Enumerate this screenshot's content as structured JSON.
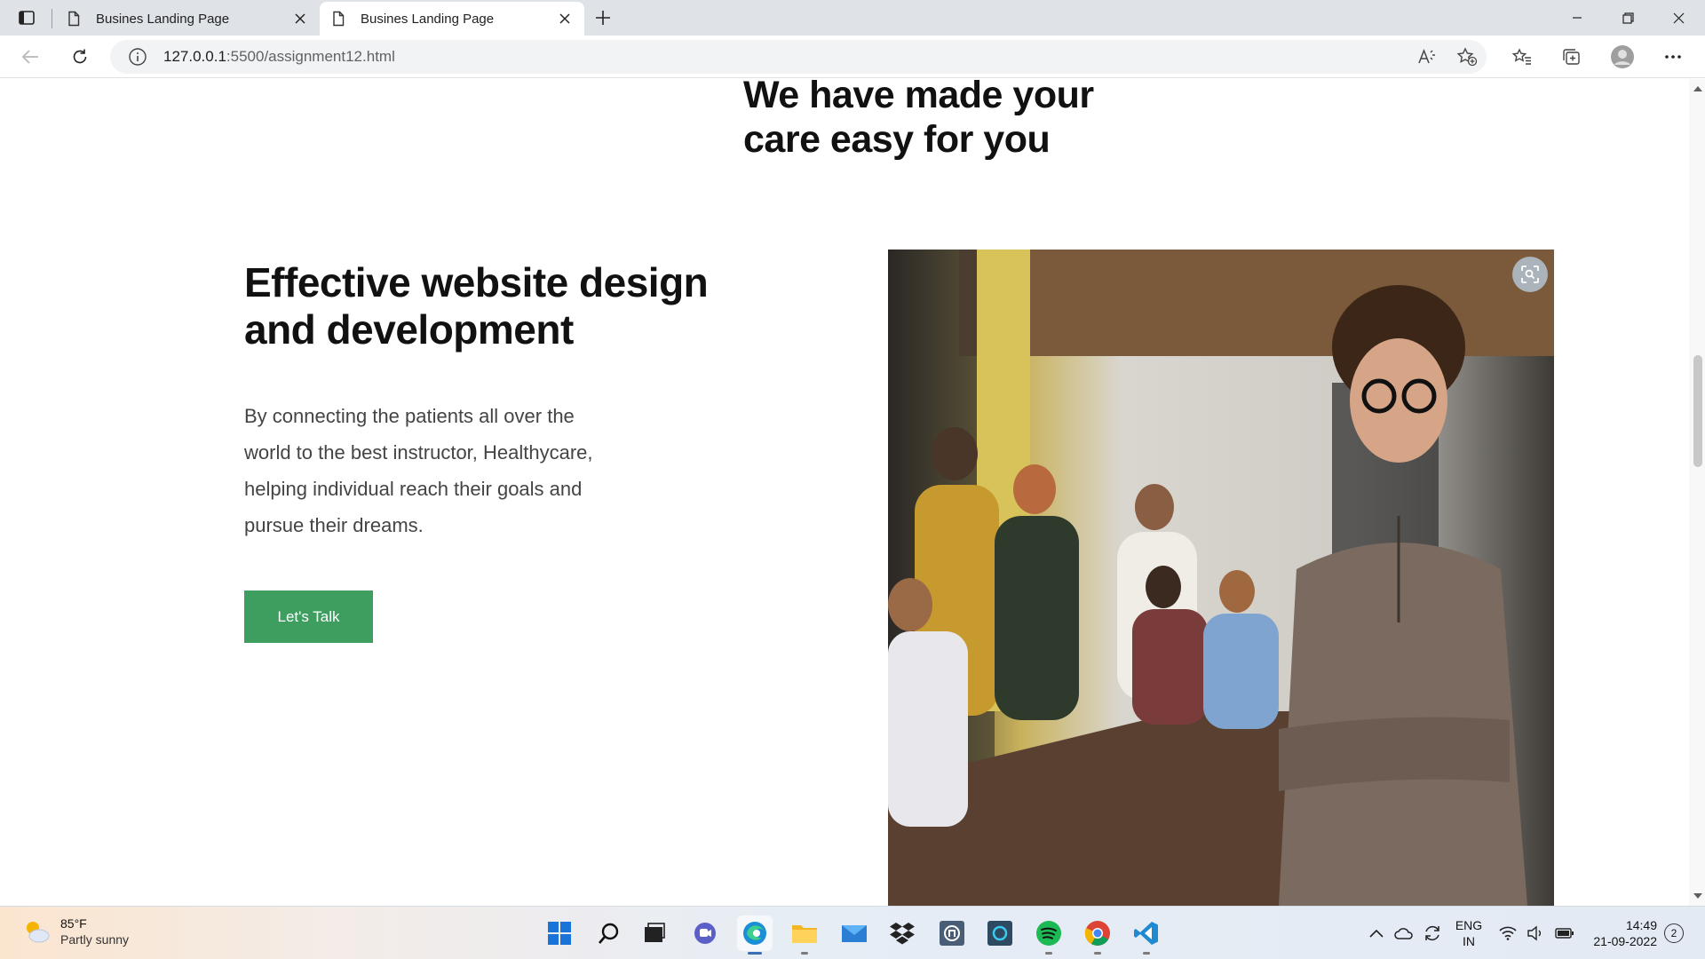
{
  "browser": {
    "tabs": [
      {
        "title": "Busines Landing Page",
        "active": false
      },
      {
        "title": "Busines Landing Page",
        "active": true
      }
    ],
    "url_host": "127.0.0.1",
    "url_path": ":5500/assignment12.html"
  },
  "page": {
    "section_heading_line1": "We have made your",
    "section_heading_line2": "care easy for you",
    "hero_title_line1": "Effective website design",
    "hero_title_line2": "and development",
    "hero_text": "By connecting the patients all over the world to the best instructor, Healthycare, helping individual reach their goals and pursue their dreams.",
    "cta_label": "Let's Talk",
    "accent_color": "#3d9e60"
  },
  "taskbar": {
    "weather_temp": "85°F",
    "weather_desc": "Partly sunny",
    "apps": [
      "windows-start",
      "search",
      "task-view",
      "teams-chat",
      "edge",
      "file-explorer",
      "mail",
      "dropbox",
      "app-tile",
      "cortana-app",
      "spotify",
      "chrome",
      "vscode"
    ],
    "lang_line1": "ENG",
    "lang_line2": "IN",
    "time": "14:49",
    "date": "21-09-2022",
    "notifications": "2"
  }
}
